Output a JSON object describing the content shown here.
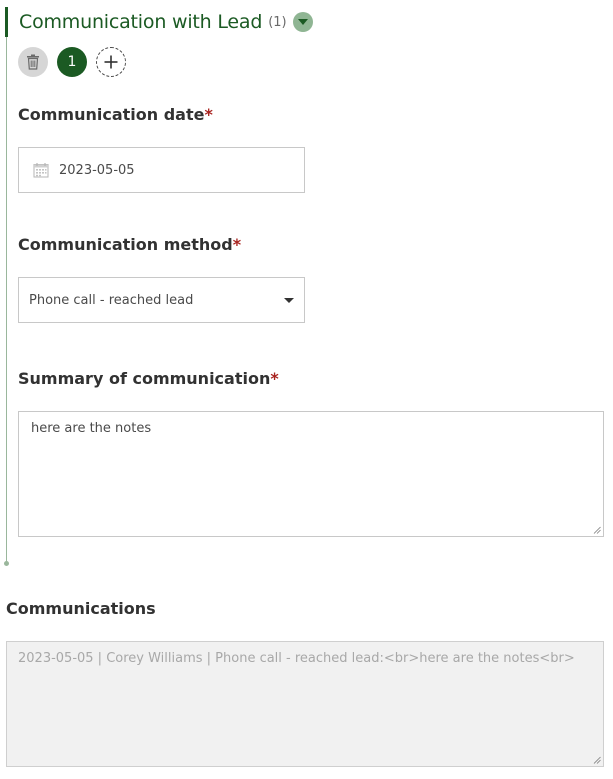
{
  "group": {
    "title": "Communication with Lead",
    "count": "(1)",
    "collapse_icon": "chevron-down-icon",
    "accent_color": "#1b5a23"
  },
  "repeat": {
    "delete_icon": "trash-icon",
    "current_page": "1",
    "add_icon": "plus-icon"
  },
  "fields": {
    "date": {
      "label": "Communication date",
      "required_mark": "*",
      "value": "2023-05-05",
      "icon": "calendar-icon"
    },
    "method": {
      "label": "Communication method",
      "required_mark": "*",
      "value": "Phone call - reached lead"
    },
    "summary": {
      "label": "Summary of communication",
      "required_mark": "*",
      "value": "here are the notes"
    }
  },
  "communications": {
    "label": "Communications",
    "value": "2023-05-05 | Corey Williams | Phone call - reached lead:<br>here are the notes<br>"
  }
}
